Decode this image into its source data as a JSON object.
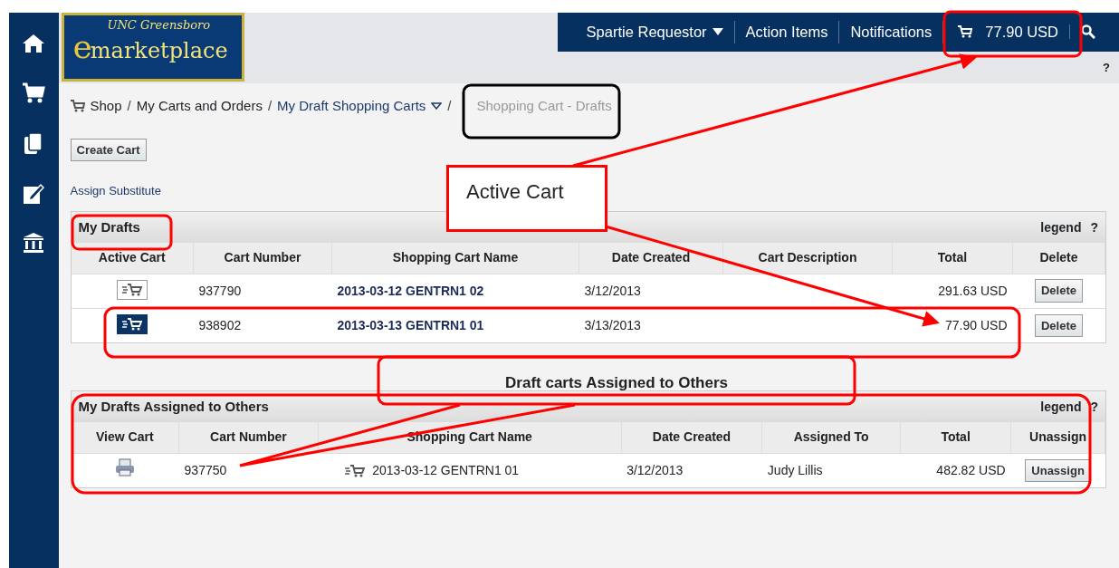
{
  "logo": {
    "line1": "UNC Greensboro",
    "letter": "e",
    "line2": "marketplace"
  },
  "top_nav": [
    {
      "label": "Spartie Requestor",
      "kind": "dropdown"
    },
    {
      "label": "Action Items",
      "kind": "link"
    },
    {
      "label": "Notifications",
      "kind": "link"
    },
    {
      "label": "77.90 USD",
      "kind": "cart"
    }
  ],
  "help": "?",
  "breadcrumb_separators": [
    "/",
    "/",
    "/"
  ],
  "breadcrumb": [
    {
      "label": "Shop",
      "kind": "home"
    },
    {
      "label": "My Carts and Orders",
      "kind": "plain"
    },
    {
      "label": "My Draft Shopping Carts",
      "kind": "dropdown"
    },
    {
      "label": "Shopping Cart - Drafts",
      "kind": "current"
    }
  ],
  "create_button": "Create Cart",
  "assign_link": "Assign Substitute",
  "my_drafts": {
    "title": "My Drafts",
    "legend": "legend",
    "help": "?",
    "columns": [
      "Active Cart",
      "Cart Number",
      "Shopping Cart Name",
      "Date Created",
      "Cart Description",
      "Total",
      "Delete"
    ],
    "rows": [
      {
        "active": false,
        "cart_number": "937790",
        "name": "2013-03-12 GENTRN1 02",
        "date_created": "3/12/2013",
        "total": "291.63 USD",
        "action": "Delete"
      },
      {
        "active": true,
        "cart_number": "938902",
        "name": "2013-03-13 GENTRN1 01",
        "date_created": "3/13/2013",
        "total": "77.90 USD",
        "action": "Delete"
      }
    ]
  },
  "assigned": {
    "title": "My Drafts Assigned to Others",
    "legend": "legend",
    "help": "?",
    "columns": [
      "View Cart",
      "Cart Number",
      "Shopping Cart Name",
      "Date Created",
      "Assigned To",
      "Total",
      "Unassign"
    ],
    "rows": [
      {
        "cart_number": "937750",
        "name": "2013-03-12 GENTRN1 01",
        "date_created": "3/12/2013",
        "assigned_to": "Judy Lillis",
        "total": "482.82 USD",
        "action": "Unassign"
      }
    ]
  },
  "annotations": {
    "active_cart_callout": "Active Cart",
    "assigned_callout": "Draft carts Assigned to Others"
  }
}
